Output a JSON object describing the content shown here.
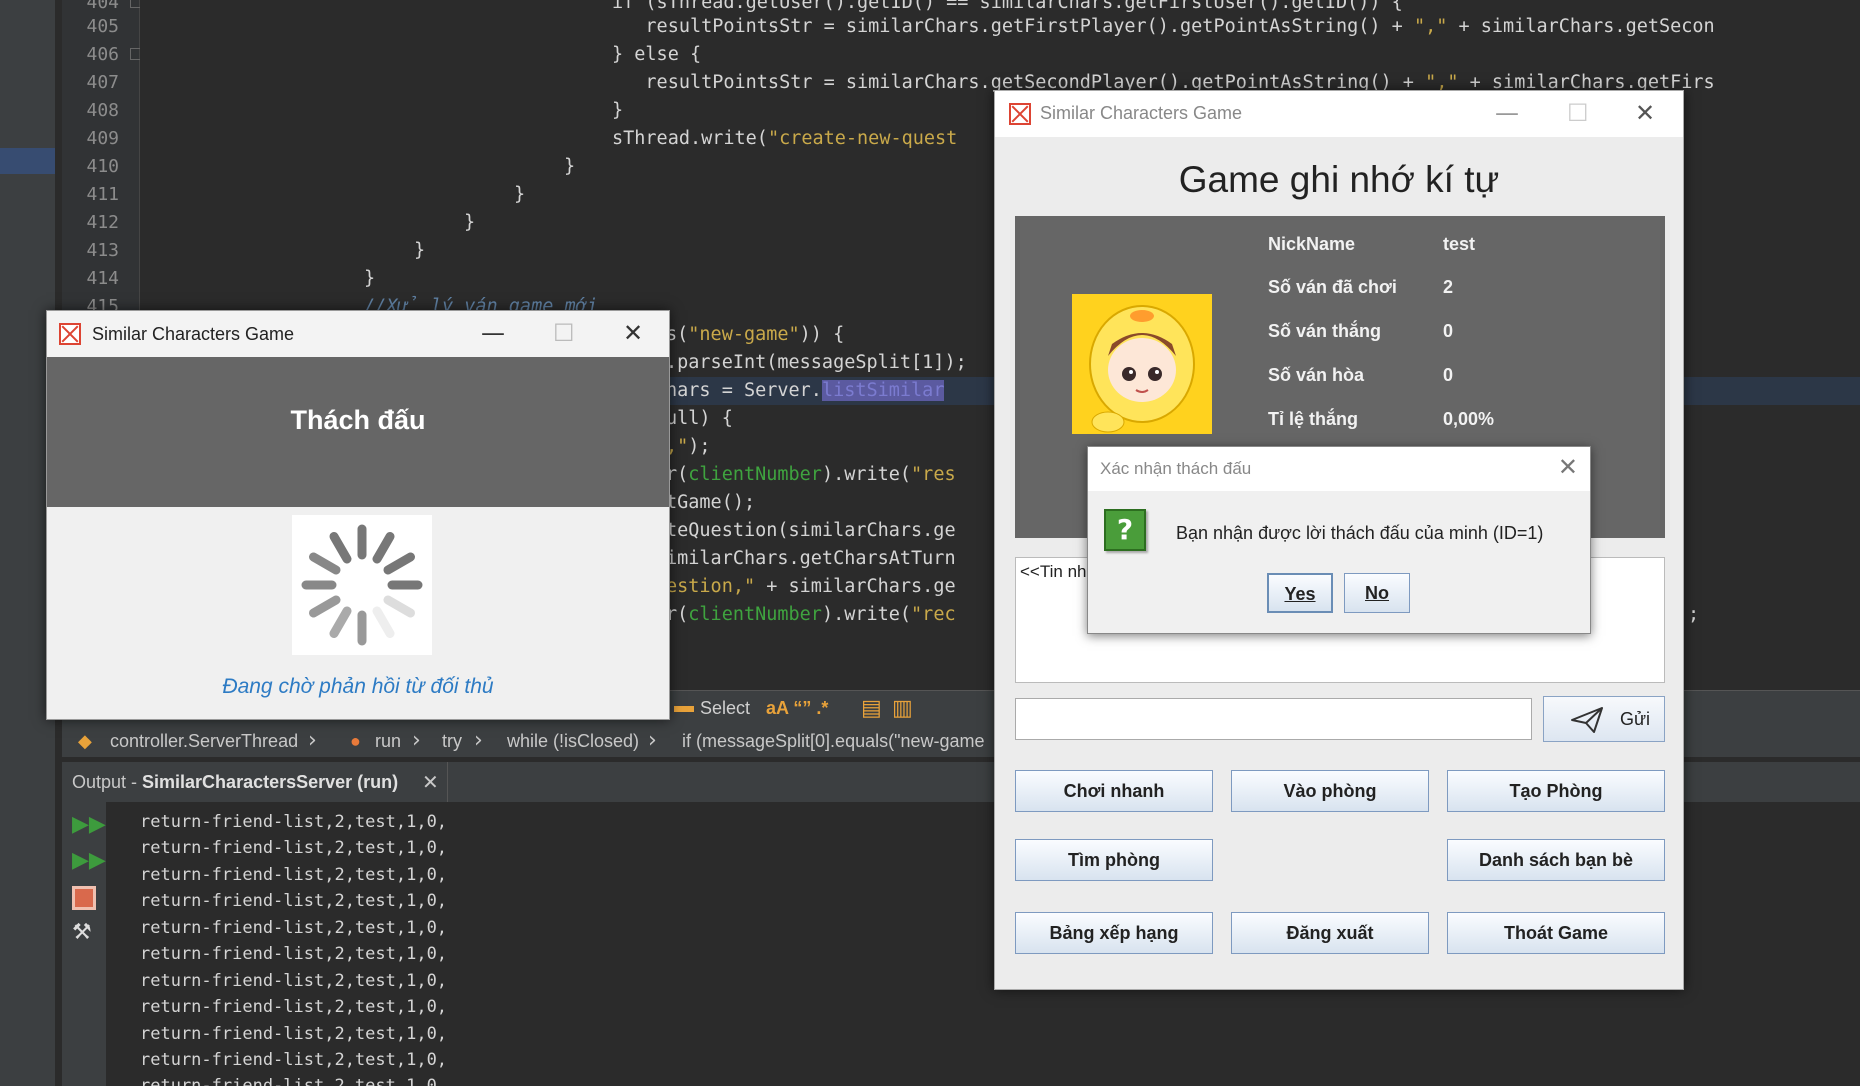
{
  "ide": {
    "line_numbers": [
      "404",
      "405",
      "406",
      "407",
      "408",
      "409",
      "410",
      "411",
      "412",
      "413",
      "414",
      "415"
    ],
    "code_lines": [
      {
        "prefix": "if (sThread.getUser().getID() == similarChars.getFirstUser().getID()) {",
        "str": "",
        "suffix": ""
      },
      {
        "prefix": "   resultPointsStr = similarChars.getFirstPlayer().getPointAsString() + ",
        "str": "\",\"",
        "suffix": " + similarChars.getSecon"
      },
      {
        "prefix": "} else {",
        "str": "",
        "suffix": ""
      },
      {
        "prefix": "   resultPointsStr = similarChars.getSecondPlayer().getPointAsString() + ",
        "str": "\",\"",
        "suffix": " + similarChars.getFirs"
      },
      {
        "prefix": "}",
        "str": "",
        "suffix": ""
      },
      {
        "prefix": "sThread.write(",
        "str": "\"create-new-quest",
        "suffix": ""
      },
      {
        "prefix": "}",
        "str": "",
        "suffix": ""
      },
      {
        "prefix": "}",
        "str": "",
        "suffix": ""
      },
      {
        "prefix": "}",
        "str": "",
        "suffix": ""
      },
      {
        "prefix": "}",
        "str": "",
        "suffix": ""
      },
      {
        "prefix": "}",
        "str": "",
        "suffix": ""
      },
      {
        "prefix": "//Xử lý ván game mới",
        "str": "",
        "suffix": ""
      }
    ],
    "code_right": {
      "l1_str": "\"new-game\"",
      "l1_prefix": "s(",
      "l1_suffix": ")) {",
      "l2": ".parseInt(messageSplit[1]);",
      "l3_prefix": "hars = Server.",
      "l3_hl": "listSimilar",
      "l4": "ull) {",
      "l5_str": ",\"",
      "l5_suffix": ");",
      "l6_prefix": "r(",
      "l6_var": "clientNumber",
      "l6_mid": ").write(",
      "l6_str": "\"res",
      "l7": "tGame();",
      "l8": "teQuestion(similarChars.ge",
      "l9": "imilarChars.getCharsAtTurn",
      "l10_str": "estion,\"",
      "l10_suffix": " + similarChars.ge",
      "l11_prefix": "r(",
      "l11_var": "clientNumber",
      "l11_mid": ").write(",
      "l11_str": "\"rec",
      "far_right": ";"
    },
    "toolbar": {
      "select": "Select",
      "icons": "aA  “”  .*"
    },
    "breadcrumb": [
      "controller.ServerThread",
      "run",
      "try",
      "while (!isClosed)",
      "if (messageSplit[0].equals(\"new-game"
    ],
    "output_tab": {
      "prefix": "Output - ",
      "name": "SimilarCharactersServer (run)",
      "close": "✕"
    },
    "output_lines": [
      "return-friend-list,2,test,1,0,",
      "return-friend-list,2,test,1,0,",
      "return-friend-list,2,test,1,0,",
      "return-friend-list,2,test,1,0,",
      "return-friend-list,2,test,1,0,",
      "return-friend-list,2,test,1,0,",
      "return-friend-list,2,test,1,0,",
      "return-friend-list,2,test,1,0,",
      "return-friend-list,2,test,1,0,",
      "return-friend-list,2,test,1,0,",
      "return-friend-list,2,test,1,0,"
    ]
  },
  "challenge_window": {
    "title": "Similar Characters Game",
    "heading": "Thách đấu",
    "waiting_text": "Đang chờ phản hồi từ đối thủ"
  },
  "main_window": {
    "title": "Similar Characters Game",
    "heading": "Game ghi nhớ kí tự",
    "profile": {
      "rows": [
        {
          "label": "NickName",
          "value": "test"
        },
        {
          "label": "Số ván đã chơi",
          "value": "2"
        },
        {
          "label": "Số ván thắng",
          "value": "0"
        },
        {
          "label": "Số ván hòa",
          "value": "0"
        },
        {
          "label": "Tỉ lệ thắng",
          "value": "0,00%"
        }
      ]
    },
    "chat_text": "<<Tin nh",
    "send_label": "Gửi",
    "buttons": {
      "quick_play": "Chơi nhanh",
      "join_room": "Vào phòng",
      "create_room": "Tạo Phòng",
      "find_room": "Tìm phòng",
      "friends_list": "Danh sách bạn bè",
      "leaderboard": "Bảng xếp hạng",
      "logout": "Đăng xuất",
      "exit_game": "Thoát Game"
    }
  },
  "confirm_dialog": {
    "title": "Xác nhận thách đấu",
    "message": "Bạn nhận được lời thách đấu của minh (ID=1)",
    "yes": "Yes",
    "no": "No",
    "close": "✕"
  },
  "window_controls": {
    "minimize": "—",
    "maximize": "☐",
    "close": "✕"
  },
  "colors": {
    "accent_blue": "#2d7bc4",
    "panel_gray": "#666666",
    "question_green": "#4a9d3a"
  }
}
